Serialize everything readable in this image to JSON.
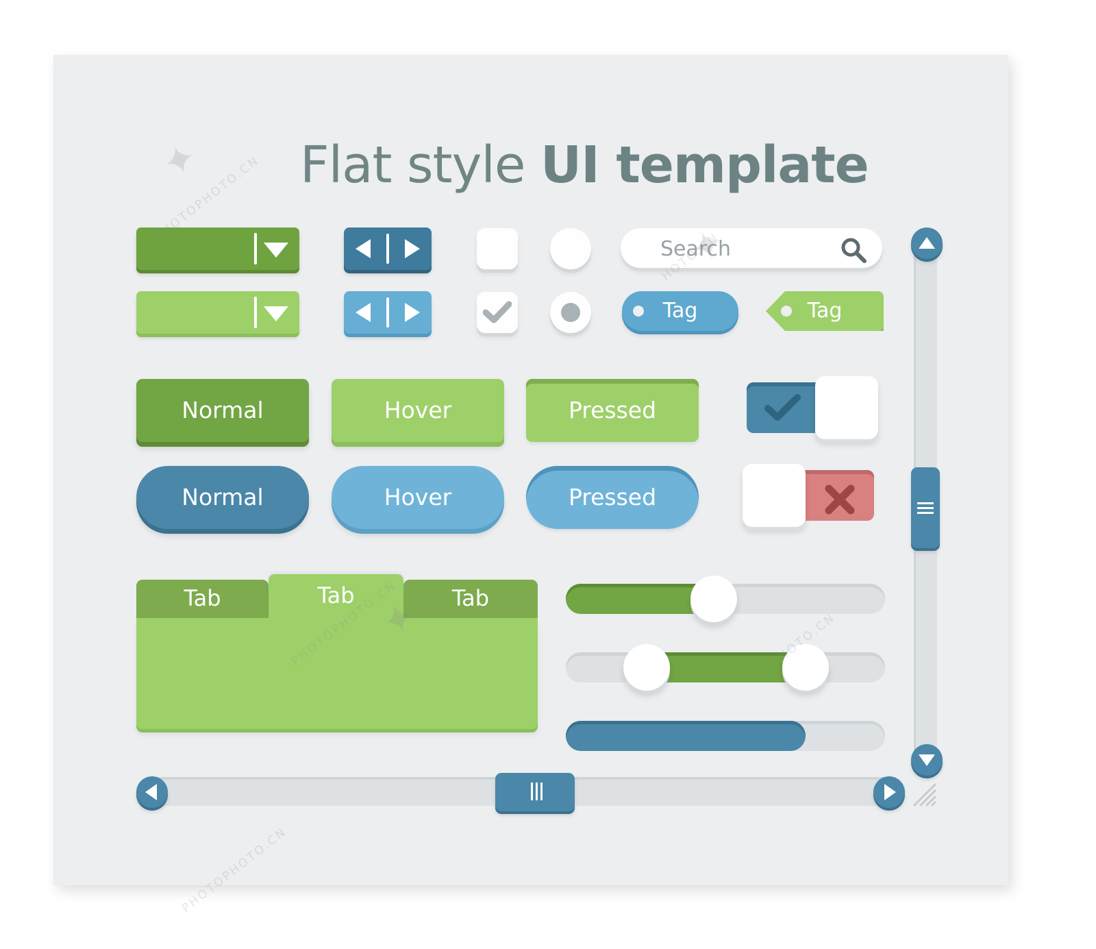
{
  "title": {
    "regular": "Flat style ",
    "bold": "UI template"
  },
  "colors": {
    "canvas_bg": "#eceef0",
    "green_dark": "#72a544",
    "green_light": "#9ed06a",
    "blue_dark": "#4a87a8",
    "blue_light": "#6fb4d8",
    "red": "#d98080",
    "track_gray": "#dde1e3",
    "title_gray": "#718585"
  },
  "dropdowns": [
    {
      "name": "dropdown-dark",
      "variant": "dark",
      "icon": "chevron-down-icon"
    },
    {
      "name": "dropdown-light",
      "variant": "light",
      "icon": "chevron-down-icon"
    }
  ],
  "nav_pairs": [
    {
      "name": "nav-pair-dark",
      "prev_icon": "arrow-left-icon",
      "next_icon": "arrow-right-icon"
    },
    {
      "name": "nav-pair-light",
      "prev_icon": "arrow-left-icon",
      "next_icon": "arrow-right-icon"
    }
  ],
  "checkboxes": [
    {
      "state": "unchecked"
    },
    {
      "state": "checked",
      "icon": "check-icon"
    }
  ],
  "radios": [
    {
      "state": "unselected"
    },
    {
      "state": "selected"
    }
  ],
  "search": {
    "placeholder": "Search",
    "icon": "search-icon"
  },
  "tags": [
    {
      "label": "Tag",
      "color": "blue"
    },
    {
      "label": "Tag",
      "color": "green"
    }
  ],
  "buttons": {
    "green_row": [
      {
        "label": "Normal",
        "state": "normal"
      },
      {
        "label": "Hover",
        "state": "hover"
      },
      {
        "label": "Pressed",
        "state": "pressed"
      }
    ],
    "blue_row": [
      {
        "label": "Normal",
        "state": "normal"
      },
      {
        "label": "Hover",
        "state": "hover"
      },
      {
        "label": "Pressed",
        "state": "pressed"
      }
    ]
  },
  "toggles": [
    {
      "name": "toggle-on",
      "state": "on",
      "icon": "check-icon",
      "color": "#4a87a8"
    },
    {
      "name": "toggle-off",
      "state": "off",
      "icon": "close-icon",
      "color": "#d98080"
    }
  ],
  "tabs": [
    {
      "label": "Tab",
      "active": false
    },
    {
      "label": "Tab",
      "active": true
    },
    {
      "label": "Tab",
      "active": false
    }
  ],
  "sliders": [
    {
      "name": "single-slider",
      "type": "single",
      "value_pct": 42,
      "color": "#72a544"
    },
    {
      "name": "range-slider",
      "type": "range",
      "low_pct": 21,
      "high_pct": 75,
      "color": "#72a544"
    },
    {
      "name": "progress-bar",
      "type": "progress",
      "value_pct": 75,
      "color": "#4a87a8"
    }
  ],
  "vertical_scrollbar": {
    "up_icon": "triangle-up-icon",
    "down_icon": "triangle-down-icon",
    "thumb_icon": "grip-horizontal-icon"
  },
  "horizontal_scrollbar": {
    "left_icon": "triangle-left-icon",
    "right_icon": "triangle-right-icon",
    "thumb_icon": "grip-vertical-icon"
  },
  "resize_grip": {
    "icon": "resize-handle-icon"
  },
  "watermarks": {
    "text": "PHOTOPHOTO.CN",
    "short": "HOTO.CN"
  }
}
